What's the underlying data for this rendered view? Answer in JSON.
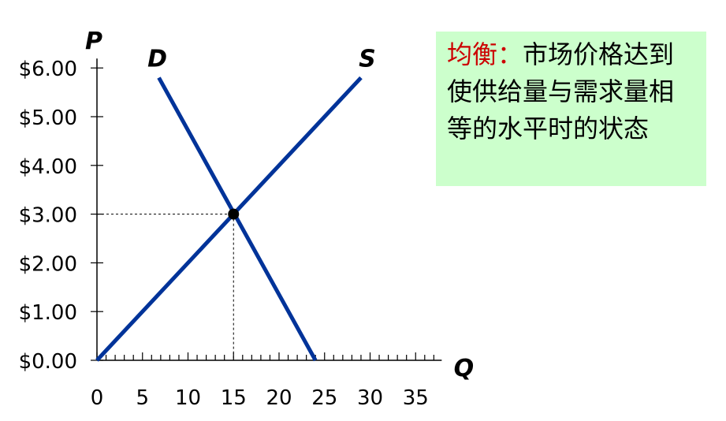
{
  "note": {
    "term": "均衡：",
    "text": "市场价格达到使供给量与需求量相等的水平时的状态"
  },
  "chart_data": {
    "type": "line",
    "xlabel": "Q",
    "ylabel": "P",
    "xlim": [
      0,
      37
    ],
    "ylim": [
      0,
      6
    ],
    "x_tick_labels": [
      "0",
      "5",
      "10",
      "15",
      "20",
      "25",
      "30",
      "35"
    ],
    "x_ticks": [
      0,
      5,
      10,
      15,
      20,
      25,
      30,
      35
    ],
    "y_tick_labels": [
      "$0.00",
      "$1.00",
      "$2.00",
      "$3.00",
      "$4.00",
      "$5.00",
      "$6.00"
    ],
    "y_ticks": [
      0,
      1,
      2,
      3,
      4,
      5,
      6
    ],
    "series": [
      {
        "name": "D",
        "x": [
          6.8,
          24
        ],
        "y": [
          5.8,
          0
        ],
        "color": "#003399"
      },
      {
        "name": "S",
        "x": [
          0,
          29
        ],
        "y": [
          0,
          5.8
        ],
        "color": "#003399"
      }
    ],
    "equilibrium": {
      "x": 15,
      "y": 3
    }
  }
}
